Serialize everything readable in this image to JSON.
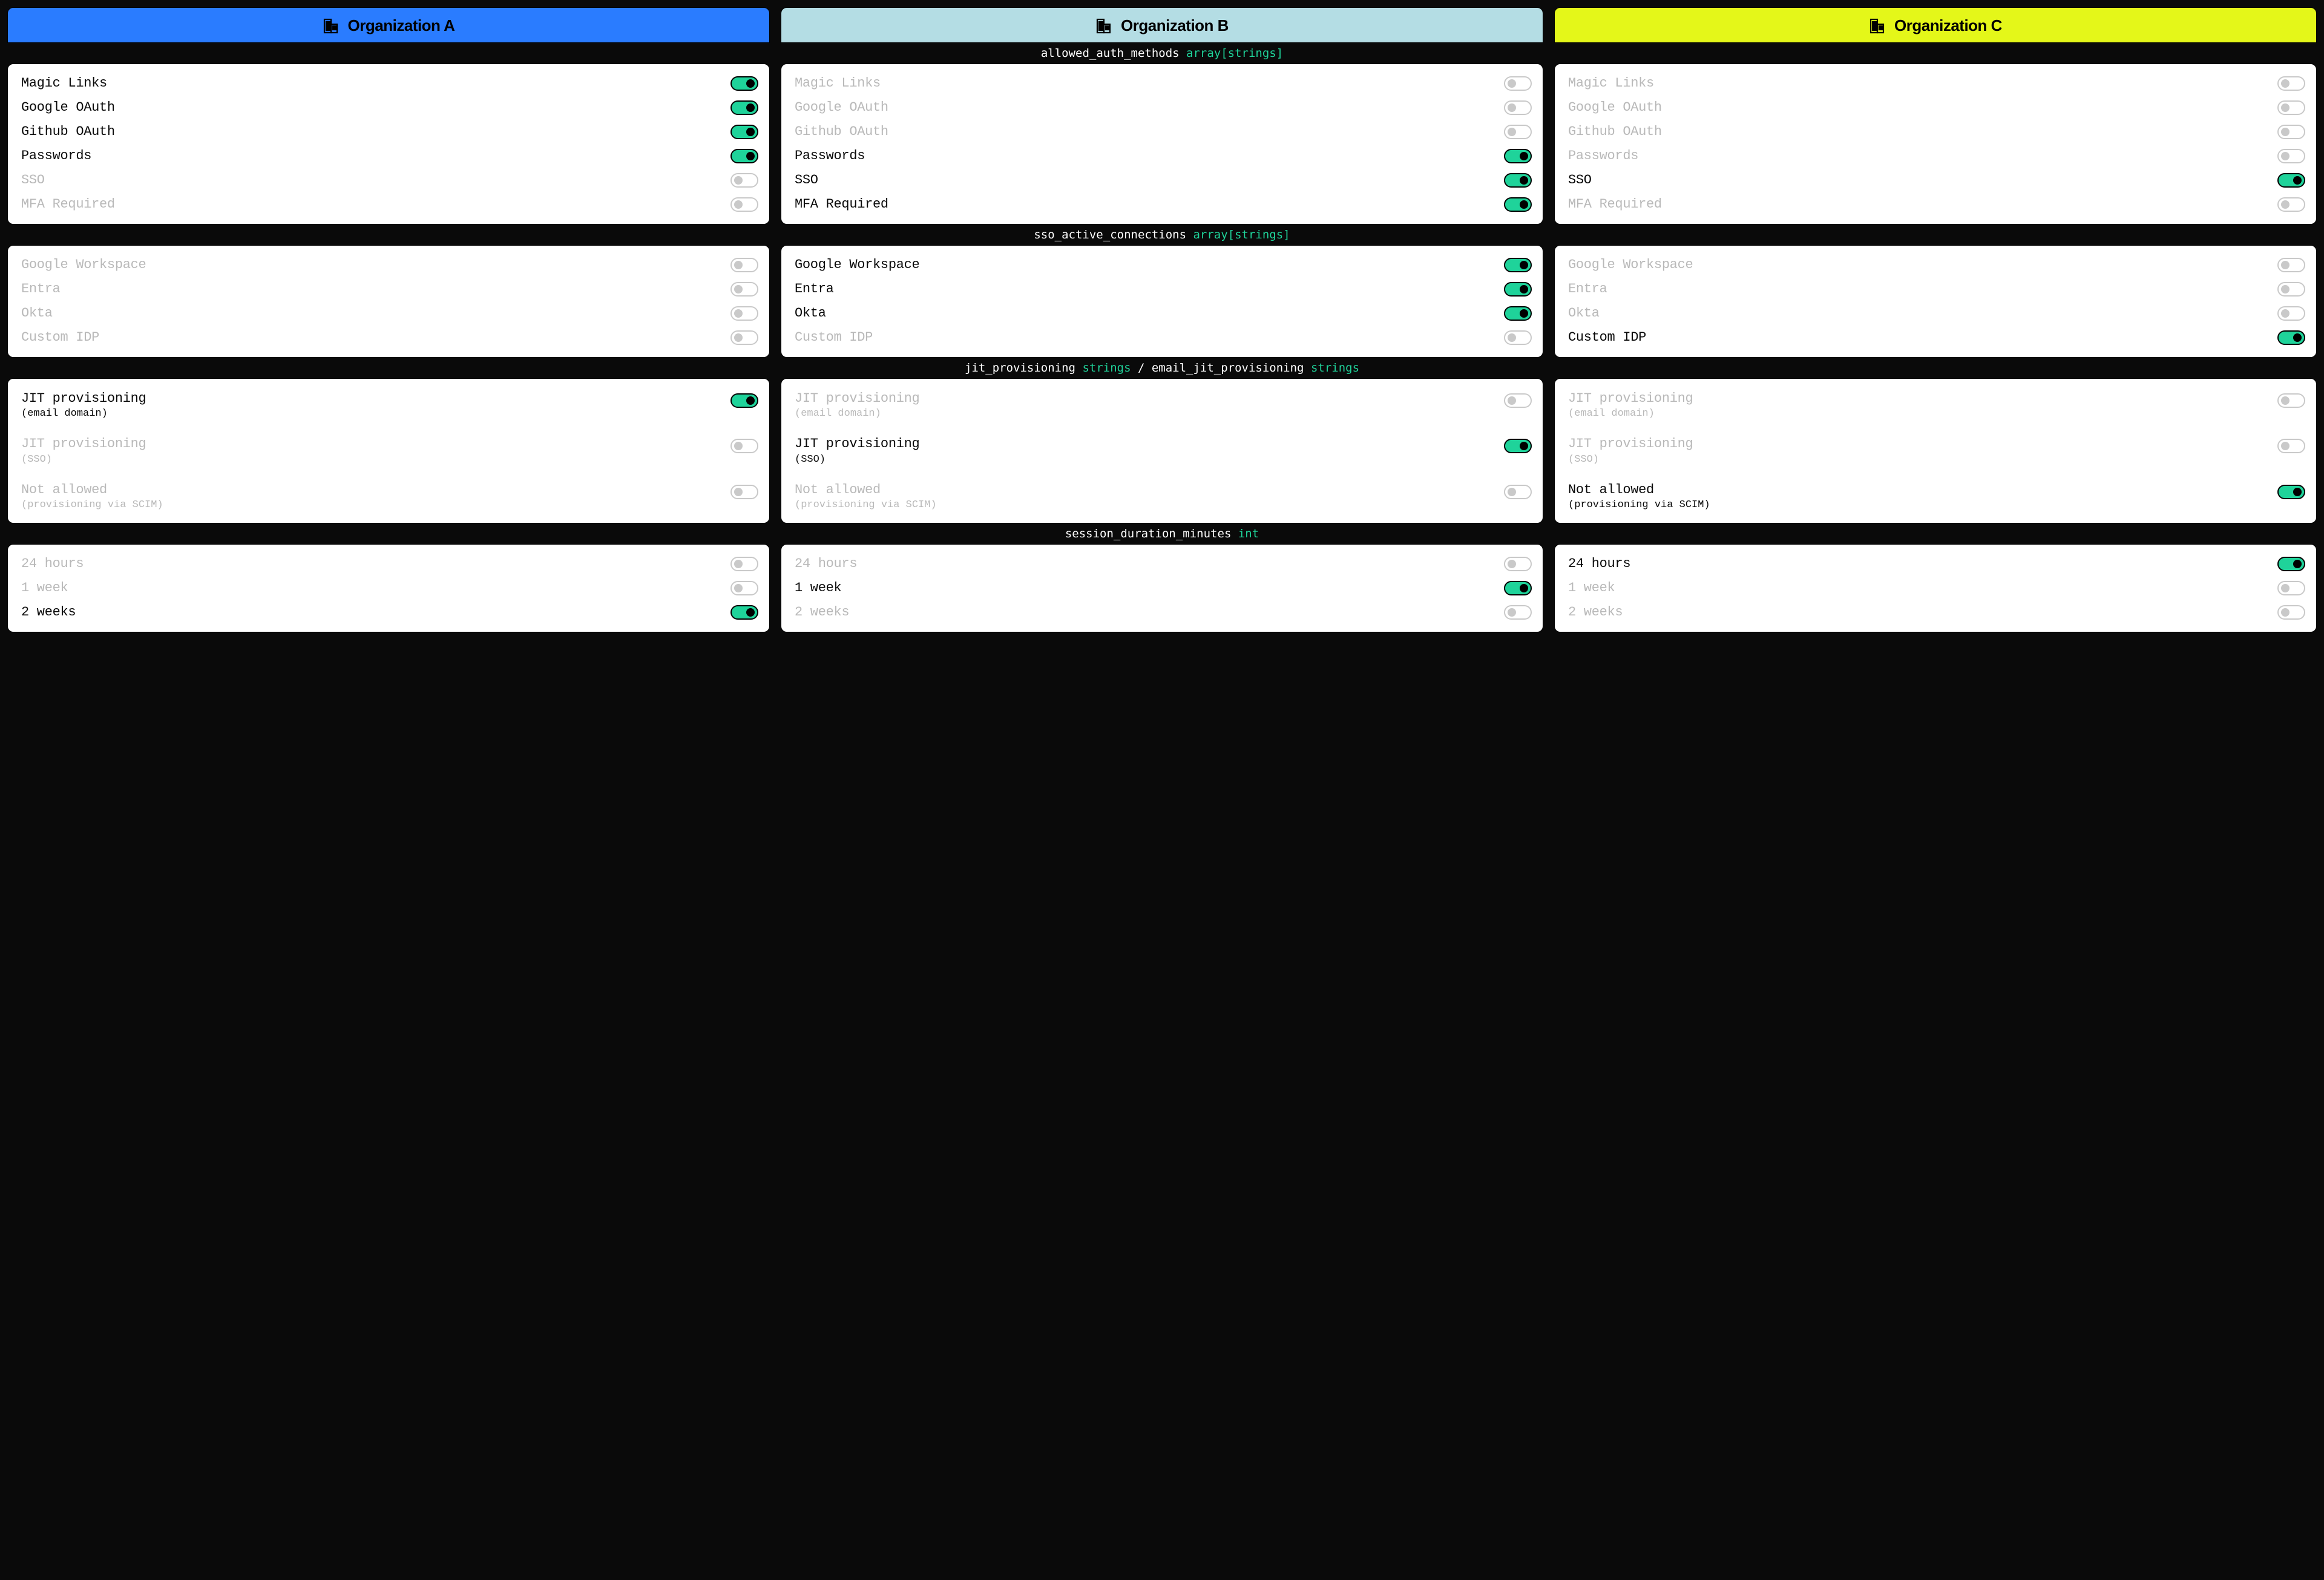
{
  "orgs": [
    {
      "name": "Organization A",
      "header_color": "#2a7cff"
    },
    {
      "name": "Organization B",
      "header_color": "#b4dde4"
    },
    {
      "name": "Organization C",
      "header_color": "#e4f719"
    }
  ],
  "sections": {
    "auth": {
      "key": "allowed_auth_methods",
      "type": "array[strings]"
    },
    "sso": {
      "key": "sso_active_connections",
      "type": "array[strings]"
    },
    "jit": {
      "key1": "jit_provisioning",
      "type1": "strings",
      "sep": "/",
      "key2": "email_jit_provisioning",
      "type2": "strings"
    },
    "session": {
      "key": "session_duration_minutes",
      "type": "int"
    }
  },
  "labels": {
    "auth": [
      "Magic Links",
      "Google OAuth",
      "Github OAuth",
      "Passwords",
      "SSO",
      "MFA Required"
    ],
    "sso": [
      "Google Workspace",
      "Entra",
      "Okta",
      "Custom IDP"
    ],
    "jit": [
      {
        "main": "JIT provisioning",
        "sub": "(email domain)"
      },
      {
        "main": "JIT provisioning",
        "sub": "(SSO)"
      },
      {
        "main": "Not allowed",
        "sub": "(provisioning via SCIM)"
      }
    ],
    "session": [
      "24 hours",
      "1 week",
      "2 weeks"
    ]
  },
  "values": {
    "auth": [
      [
        true,
        true,
        true,
        true,
        false,
        false
      ],
      [
        false,
        false,
        false,
        true,
        true,
        true
      ],
      [
        false,
        false,
        false,
        false,
        true,
        false
      ]
    ],
    "sso": [
      [
        false,
        false,
        false,
        false
      ],
      [
        true,
        true,
        true,
        false
      ],
      [
        false,
        false,
        false,
        true
      ]
    ],
    "jit": [
      [
        true,
        false,
        false
      ],
      [
        false,
        true,
        false
      ],
      [
        false,
        false,
        true
      ]
    ],
    "session": [
      [
        false,
        false,
        true
      ],
      [
        false,
        true,
        false
      ],
      [
        true,
        false,
        false
      ]
    ]
  }
}
